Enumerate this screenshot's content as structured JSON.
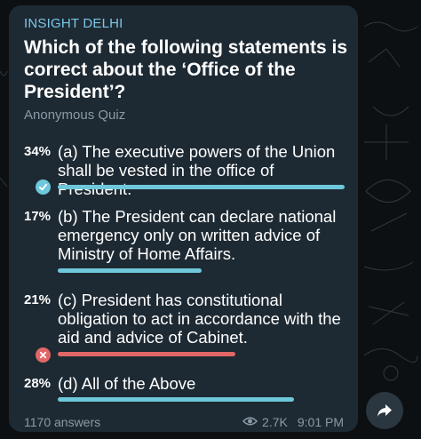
{
  "message": {
    "channel": "INSIGHT DELHI",
    "question": "Which of the following statements is correct about the ‘Office of the President’?",
    "quiz_type": "Anonymous Quiz",
    "answers_count": "1170 answers",
    "views": "2.7K",
    "time": "9:01 PM"
  },
  "options": [
    {
      "percent_label": "34%",
      "percent": 34,
      "text": "(a) The executive powers of the Union shall be vested in the office of President.",
      "state": "correct",
      "bar_color": "#6ec7da"
    },
    {
      "percent_label": "17%",
      "percent": 17,
      "text": "(b) The President can declare national emergency only on written advice of Ministry of Home Affairs.",
      "state": "none",
      "bar_color": "#6ec7da"
    },
    {
      "percent_label": "21%",
      "percent": 21,
      "text": "(c) President has constitutional obligation to act in accordance with the aid and advice of Cabinet.",
      "state": "wrong",
      "bar_color": "#e16767"
    },
    {
      "percent_label": "28%",
      "percent": 28,
      "text": "(d) All of the Above",
      "state": "none",
      "bar_color": "#6ec7da"
    }
  ],
  "icons": {
    "correct": "check-icon",
    "wrong": "cross-icon",
    "views": "eye-icon",
    "share": "share-arrow-icon"
  },
  "colors": {
    "bubble": "#1e2a33",
    "channel": "#7cc6e8",
    "correct": "#6ec7da",
    "wrong": "#e16767"
  }
}
